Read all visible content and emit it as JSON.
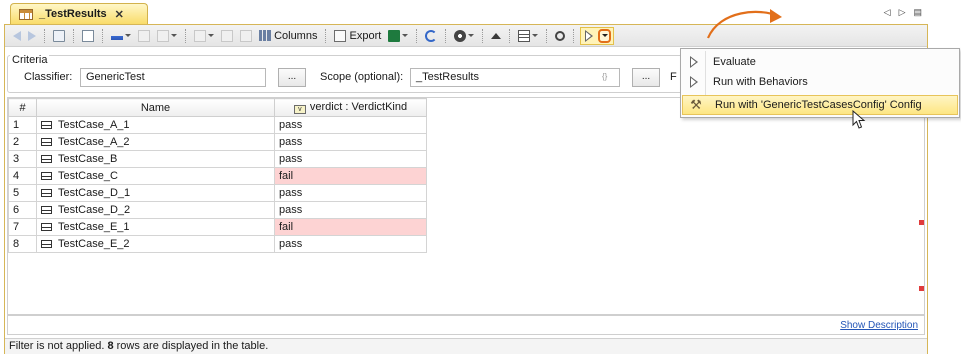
{
  "tab": {
    "title": "_TestResults",
    "close_glyph": "✕",
    "nav_left": "◁",
    "nav_right": "▷",
    "nav_menu": "▤"
  },
  "toolbar": {
    "columns_label": "Columns",
    "export_label": "Export"
  },
  "criteria": {
    "legend": "Criteria",
    "classifier_label": "Classifier:",
    "classifier_value": "GenericTest",
    "browse_label": "...",
    "scope_label": "Scope (optional):",
    "scope_value": "_TestResults",
    "regex_glyph": "{}",
    "filter_label": "F"
  },
  "table": {
    "columns": {
      "num": "#",
      "name": "Name",
      "verdict": "verdict : VerdictKind"
    },
    "rows": [
      {
        "num": "1",
        "name": "TestCase_A_1",
        "verdict": "pass"
      },
      {
        "num": "2",
        "name": "TestCase_A_2",
        "verdict": "pass"
      },
      {
        "num": "3",
        "name": "TestCase_B",
        "verdict": "pass"
      },
      {
        "num": "4",
        "name": "TestCase_C",
        "verdict": "fail"
      },
      {
        "num": "5",
        "name": "TestCase_D_1",
        "verdict": "pass"
      },
      {
        "num": "6",
        "name": "TestCase_D_2",
        "verdict": "pass"
      },
      {
        "num": "7",
        "name": "TestCase_E_1",
        "verdict": "fail"
      },
      {
        "num": "8",
        "name": "TestCase_E_2",
        "verdict": "pass"
      }
    ]
  },
  "description": {
    "link": "Show Description"
  },
  "status": {
    "prefix": "Filter is not applied.",
    "count": "8",
    "suffix": "rows are displayed in the table."
  },
  "menu": {
    "items": [
      {
        "label": "Evaluate",
        "icon": "play-icon"
      },
      {
        "label": "Run with Behaviors",
        "icon": "play-icon"
      },
      {
        "label": "Run with 'GenericTestCasesConfig' Config",
        "icon": "tools-icon"
      }
    ]
  },
  "colors": {
    "fail_bg": "#fdd3d3",
    "tab_accent": "#f9dc6a",
    "annotation_arrow": "#e26f1a",
    "highlight": "#fde683",
    "link": "#2355b7"
  }
}
